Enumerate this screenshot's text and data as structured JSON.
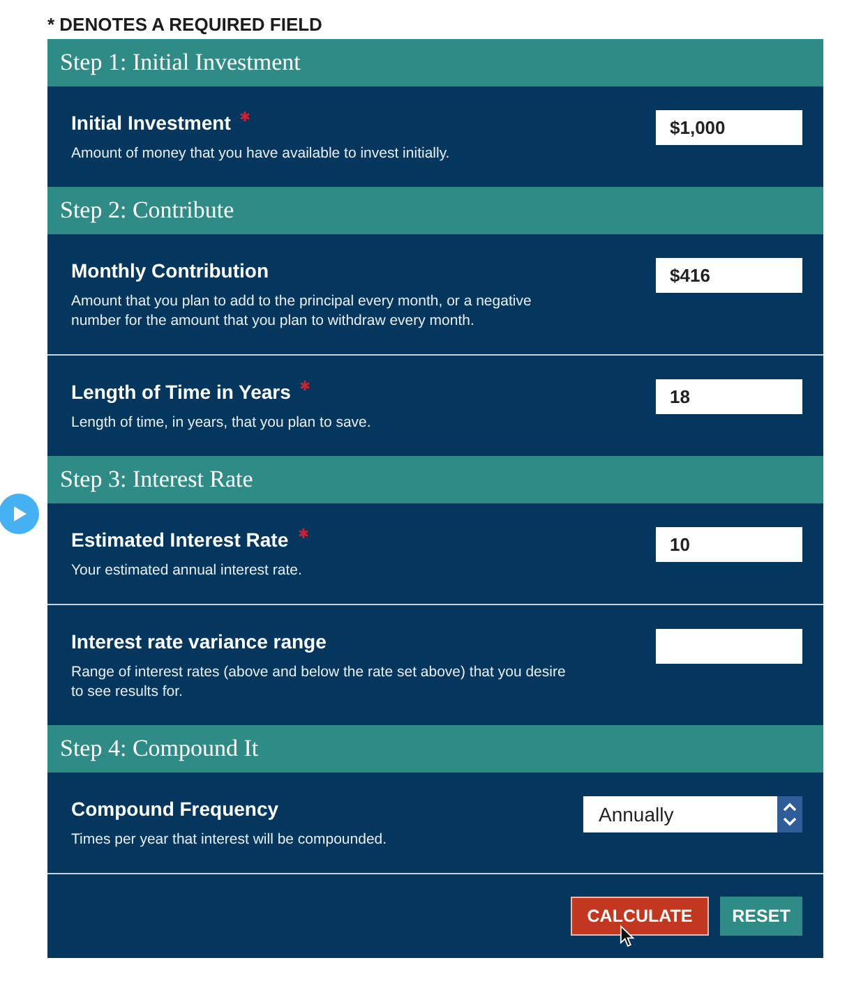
{
  "note": "* DENOTES A REQUIRED FIELD",
  "steps": [
    {
      "title": "Step 1: Initial Investment",
      "fields": [
        {
          "kind": "text",
          "label": "Initial Investment",
          "required": true,
          "description": "Amount of money that you have available to invest initially.",
          "value": "$1,000"
        }
      ]
    },
    {
      "title": "Step 2: Contribute",
      "fields": [
        {
          "kind": "text",
          "label": "Monthly Contribution",
          "required": false,
          "description": "Amount that you plan to add to the principal every month, or a negative number for the amount that you plan to withdraw every month.",
          "value": "$416"
        },
        {
          "kind": "text",
          "label": "Length of Time in Years",
          "required": true,
          "description": "Length of time, in years, that you plan to save.",
          "value": "18"
        }
      ]
    },
    {
      "title": "Step 3: Interest Rate",
      "fields": [
        {
          "kind": "text",
          "label": "Estimated Interest Rate",
          "required": true,
          "description": "Your estimated annual interest rate.",
          "value": "10"
        },
        {
          "kind": "text",
          "label": "Interest rate variance range",
          "required": false,
          "description": "Range of interest rates (above and below the rate set above) that you desire to see results for."
        }
      ]
    },
    {
      "title": "Step 4: Compound It",
      "fields": [
        {
          "kind": "select",
          "label": "Compound Frequency",
          "required": false,
          "description": "Times per year that interest will be compounded.",
          "value": "Annually"
        }
      ]
    }
  ],
  "buttons": [
    {
      "kind": "primary",
      "label": "CALCULATE"
    },
    {
      "kind": "secondary",
      "label": "RESET"
    }
  ]
}
